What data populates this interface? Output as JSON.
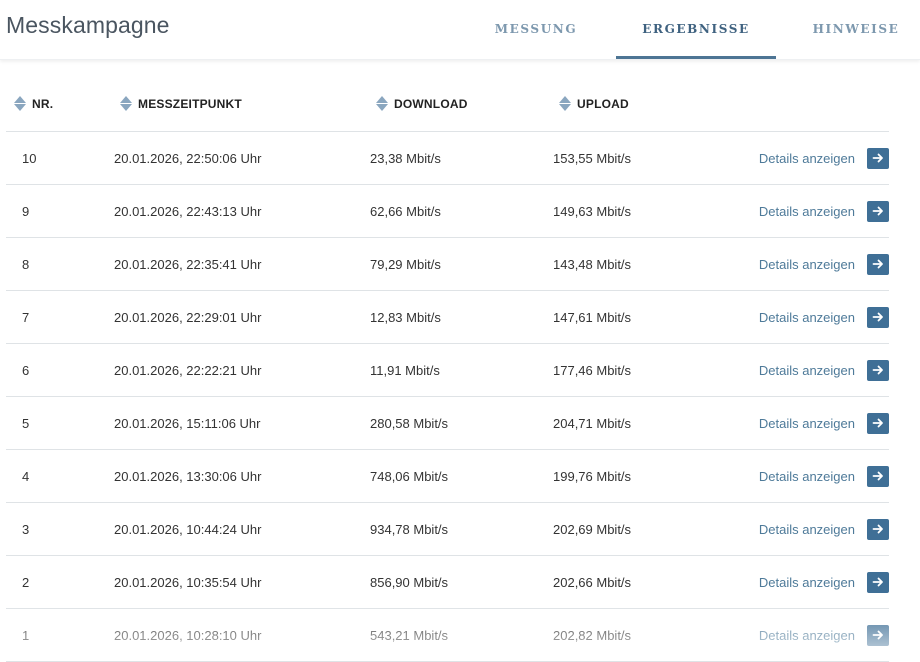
{
  "app": {
    "title": "Messkampagne"
  },
  "tabs": [
    {
      "label": "MESSUNG",
      "active": false
    },
    {
      "label": "ERGEBNISSE",
      "active": true
    },
    {
      "label": "HINWEISE",
      "active": false
    }
  ],
  "table": {
    "columns": [
      "NR.",
      "MESSZEITPUNKT",
      "DOWNLOAD",
      "UPLOAD"
    ],
    "details_label": "Details anzeigen",
    "rows": [
      {
        "nr": "10",
        "time": "20.01.2026, 22:50:06 Uhr",
        "download": "23,38 Mbit/s",
        "upload": "153,55 Mbit/s"
      },
      {
        "nr": "9",
        "time": "20.01.2026, 22:43:13 Uhr",
        "download": "62,66 Mbit/s",
        "upload": "149,63 Mbit/s"
      },
      {
        "nr": "8",
        "time": "20.01.2026, 22:35:41 Uhr",
        "download": "79,29 Mbit/s",
        "upload": "143,48 Mbit/s"
      },
      {
        "nr": "7",
        "time": "20.01.2026, 22:29:01 Uhr",
        "download": "12,83 Mbit/s",
        "upload": "147,61 Mbit/s"
      },
      {
        "nr": "6",
        "time": "20.01.2026, 22:22:21 Uhr",
        "download": "11,91 Mbit/s",
        "upload": "177,46 Mbit/s"
      },
      {
        "nr": "5",
        "time": "20.01.2026, 15:11:06 Uhr",
        "download": "280,58 Mbit/s",
        "upload": "204,71 Mbit/s"
      },
      {
        "nr": "4",
        "time": "20.01.2026, 13:30:06 Uhr",
        "download": "748,06 Mbit/s",
        "upload": "199,76 Mbit/s"
      },
      {
        "nr": "3",
        "time": "20.01.2026, 10:44:24 Uhr",
        "download": "934,78 Mbit/s",
        "upload": "202,69 Mbit/s"
      },
      {
        "nr": "2",
        "time": "20.01.2026, 10:35:54 Uhr",
        "download": "856,90 Mbit/s",
        "upload": "202,66 Mbit/s"
      },
      {
        "nr": "1",
        "time": "20.01.2026, 10:28:10 Uhr",
        "download": "543,21 Mbit/s",
        "upload": "202,82 Mbit/s"
      }
    ]
  },
  "icons": {
    "sort": "sort-icon",
    "details_arrow": "arrow-right-icon"
  },
  "colors": {
    "accent": "#3f6f96",
    "tab_active": "#3f6280",
    "tab_inactive": "#7d98ae",
    "link": "#4e7a99",
    "sort_icon": "#8aa6bf"
  }
}
